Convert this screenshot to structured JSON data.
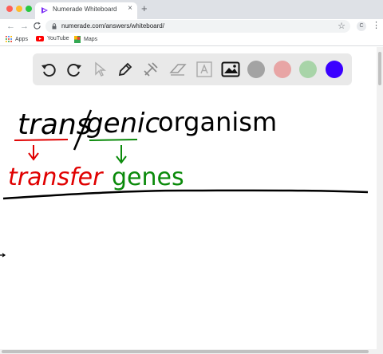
{
  "browser": {
    "tab_title": "Numerade Whiteboard",
    "tab_close": "×",
    "new_tab": "+",
    "url": "numerade.com/answers/whiteboard/",
    "profile_initial": "C",
    "back_icon": "←",
    "forward_icon": "→",
    "reload_icon": "C",
    "star_icon": "☆",
    "menu_icon": "⋮"
  },
  "bookmarks": [
    {
      "label": "Apps",
      "icon": "apps-grid-icon"
    },
    {
      "label": "YouTube",
      "icon": "youtube-icon"
    },
    {
      "label": "Maps",
      "icon": "maps-icon"
    }
  ],
  "whiteboard": {
    "tools": [
      "undo-icon",
      "redo-icon",
      "pointer-icon",
      "pen-icon",
      "tools-icon",
      "eraser-icon",
      "text-icon",
      "image-icon"
    ],
    "colors": [
      "#a3a3a3",
      "#e8a5a5",
      "#a8d4a8",
      "#3a00ff"
    ]
  },
  "content": {
    "word_main": "transgenic organism",
    "word_trans": "trans",
    "word_genic": "genic",
    "word_organism": "organism",
    "word_transfer": "transfer",
    "word_genes": "genes",
    "ink_black": "#000000",
    "ink_red": "#e00000",
    "ink_green": "#0a8a0a"
  }
}
